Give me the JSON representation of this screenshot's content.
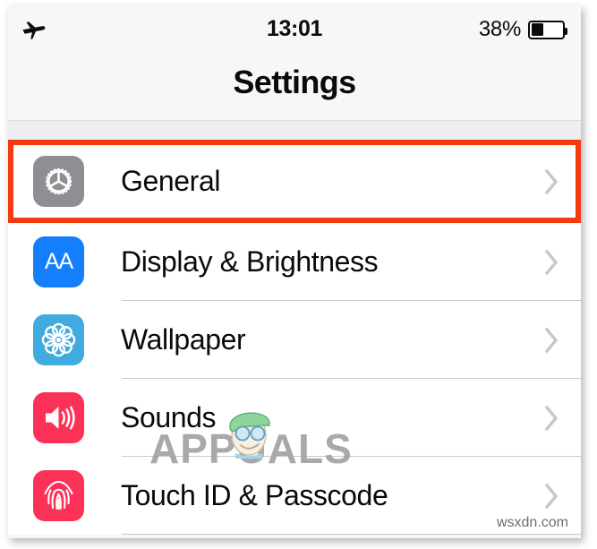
{
  "status_bar": {
    "airplane_icon": "airplane-mode-icon",
    "time": "13:01",
    "battery_percent_label": "38%",
    "battery_level": 38,
    "battery_icon": "battery-icon"
  },
  "nav": {
    "title": "Settings"
  },
  "colors": {
    "highlight_border": "#f43a10",
    "general_icon_bg": "#8e8e93",
    "display_icon_bg": "#157efb",
    "wallpaper_icon_bg": "#3fabdf",
    "sounds_icon_bg": "#fc3158",
    "touchid_icon_bg": "#fc3158",
    "chevron": "#c7c7cc",
    "separator": "#c9c9cb",
    "page_bg": "#f7f7f7",
    "group_gap_bg": "#eeedf1"
  },
  "settings_rows": [
    {
      "label": "General",
      "icon_name": "gear-icon",
      "icon_bg": "#8e8e93",
      "highlighted": true,
      "chevron": "chevron-right-icon"
    },
    {
      "label": "Display & Brightness",
      "icon_name": "aa-text-size-icon",
      "icon_bg": "#157efb",
      "icon_text": "AA",
      "highlighted": false,
      "chevron": "chevron-right-icon"
    },
    {
      "label": "Wallpaper",
      "icon_name": "flower-rosette-icon",
      "icon_bg": "#3fabdf",
      "highlighted": false,
      "chevron": "chevron-right-icon"
    },
    {
      "label": "Sounds",
      "icon_name": "speaker-volume-icon",
      "icon_bg": "#fc3158",
      "highlighted": false,
      "chevron": "chevron-right-icon"
    },
    {
      "label": "Touch ID & Passcode",
      "icon_name": "fingerprint-icon",
      "icon_bg": "#fc3158",
      "highlighted": false,
      "chevron": "chevron-right-icon"
    }
  ],
  "watermarks": {
    "primary": "APPUALS",
    "secondary": "wsxdn.com"
  }
}
